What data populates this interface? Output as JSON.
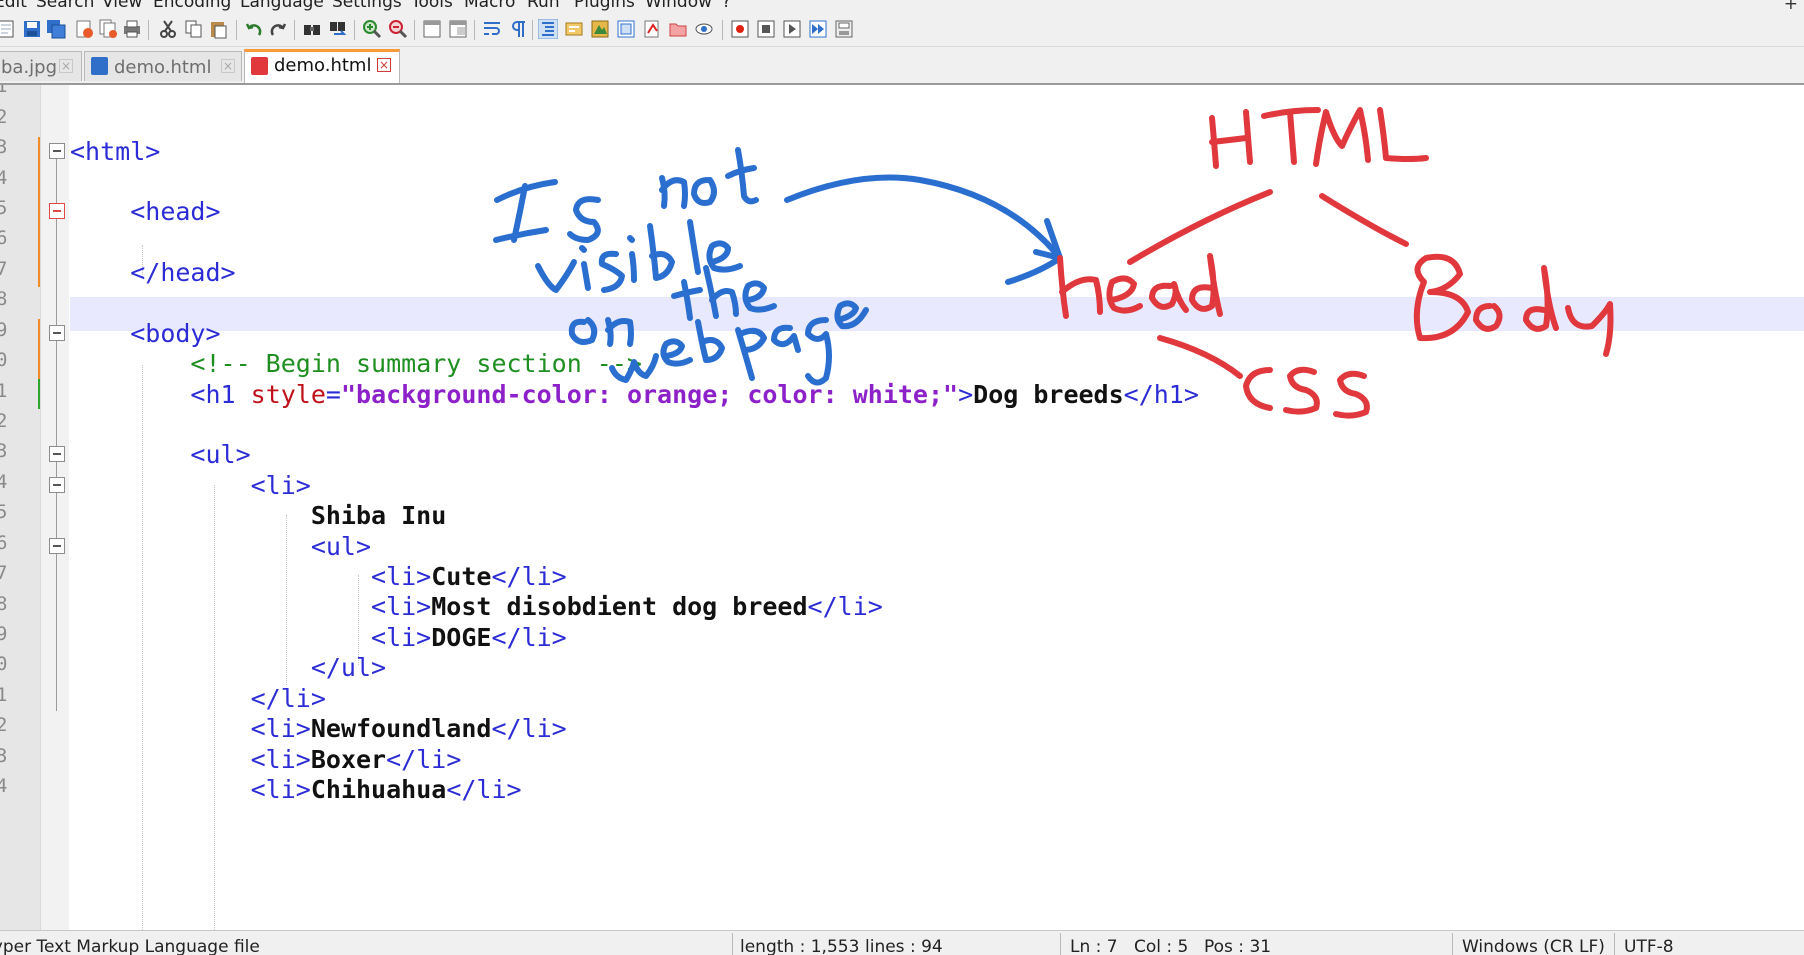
{
  "menubar": {
    "items": [
      "Edit",
      "Search",
      "View",
      "Encoding",
      "Language",
      "Settings",
      "Tools",
      "Macro",
      "Run",
      "Plugins",
      "Window",
      "?"
    ],
    "plus": "+"
  },
  "tabs": [
    {
      "label": "ba.jpg",
      "state": "inactive",
      "close": "×"
    },
    {
      "label": "demo.html",
      "state": "inactive-saved",
      "close": "×"
    },
    {
      "label": "demo.html",
      "state": "active-modified",
      "close": "×"
    }
  ],
  "line_numbers": [
    "1",
    "2",
    "3",
    "4",
    "5",
    "6",
    "7",
    "8",
    "9",
    "0",
    "1",
    "2",
    "3",
    "4",
    "5",
    "6",
    "7",
    "8",
    "9",
    "0",
    "1",
    "2",
    "3",
    "4"
  ],
  "code": {
    "l3": "<html>",
    "l5": "<head>",
    "l7": "</head>",
    "l9": "<body>",
    "l10": "<!-- Begin summary section -->",
    "l11": {
      "open": "<h1 ",
      "attr": "style",
      "eq": "=",
      "value": "\"background-color: orange; color: white;\"",
      "gt": ">",
      "text": "Dog breeds",
      "close": "</h1>"
    },
    "l13": "<ul>",
    "l14": "<li>",
    "l15": "Shiba Inu",
    "l16": "<ul>",
    "l17": {
      "open": "<li>",
      "text": "Cute",
      "close": "</li>"
    },
    "l18": {
      "open": "<li>",
      "text": "Most disobdient dog breed",
      "close": "</li>"
    },
    "l19": {
      "open": "<li>",
      "text": "DOGE",
      "close": "</li>"
    },
    "l20": "</ul>",
    "l21": "</li>",
    "l22": {
      "open": "<li>",
      "text": "Newfoundland",
      "close": "</li>"
    },
    "l23": {
      "open": "<li>",
      "text": "Boxer",
      "close": "</li>"
    },
    "l24": {
      "open": "<li>",
      "text": "Chihuahua",
      "close": "</li>"
    }
  },
  "annotations": {
    "blue_note": "Is not visible on the web page",
    "red_tree": [
      "HTML",
      "head",
      "Body",
      "CSS"
    ]
  },
  "statusbar": {
    "file_type": "Hyper Text Markup Language file",
    "length": "length : 1,553",
    "lines": "lines : 94",
    "ln": "Ln : 7",
    "col": "Col : 5",
    "pos": "Pos : 31",
    "eol": "Windows (CR LF)",
    "encoding": "UTF-8"
  },
  "colors": {
    "tag": "#2c2cd6",
    "attribute": "#c0101a",
    "value": "#8d21c9",
    "comment": "#1f8f22",
    "current_line": "#e8e8ff",
    "annotation_blue": "#2a6fd0",
    "annotation_red": "#e0383d"
  }
}
